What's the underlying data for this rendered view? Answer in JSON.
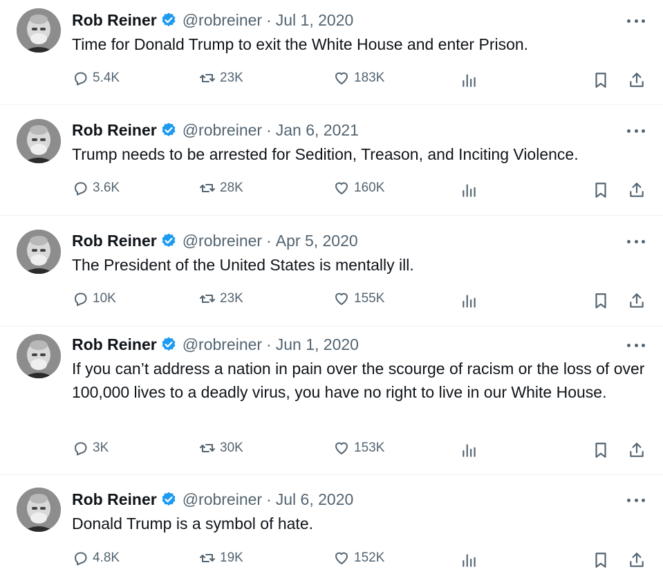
{
  "author": {
    "name": "Rob Reiner",
    "handle": "@robreiner",
    "separator": "·"
  },
  "tweets": [
    {
      "date": "Jul 1, 2020",
      "text": "Time for Donald Trump to exit the White House and enter Prison.",
      "replies": "5.4K",
      "retweets": "23K",
      "likes": "183K"
    },
    {
      "date": "Jan 6, 2021",
      "text": "Trump needs to be arrested for Sedition, Treason, and Inciting Violence.",
      "replies": "3.6K",
      "retweets": "28K",
      "likes": "160K"
    },
    {
      "date": "Apr 5, 2020",
      "text": "The President of the United States is mentally ill.",
      "replies": "10K",
      "retweets": "23K",
      "likes": "155K"
    },
    {
      "date": "Jun 1, 2020",
      "text": "If you can’t address a nation in pain over the scourge of racism or the loss of over 100,000 lives to a deadly virus, you have no right to live in our White House.",
      "replies": "3K",
      "retweets": "30K",
      "likes": "153K"
    },
    {
      "date": "Jul 6, 2020",
      "text": "Donald Trump is a symbol of hate.",
      "replies": "4.8K",
      "retweets": "19K",
      "likes": "152K"
    }
  ],
  "icons": {
    "reply": "reply-icon",
    "retweet": "retweet-icon",
    "like": "heart-icon",
    "views": "views-icon",
    "bookmark": "bookmark-icon",
    "share": "share-icon",
    "more": "more-icon",
    "verified": "verified-badge-icon"
  },
  "colors": {
    "text": "#0f1419",
    "secondary": "#536471",
    "verified": "#1d9bf0",
    "divider": "#eff3f4"
  }
}
